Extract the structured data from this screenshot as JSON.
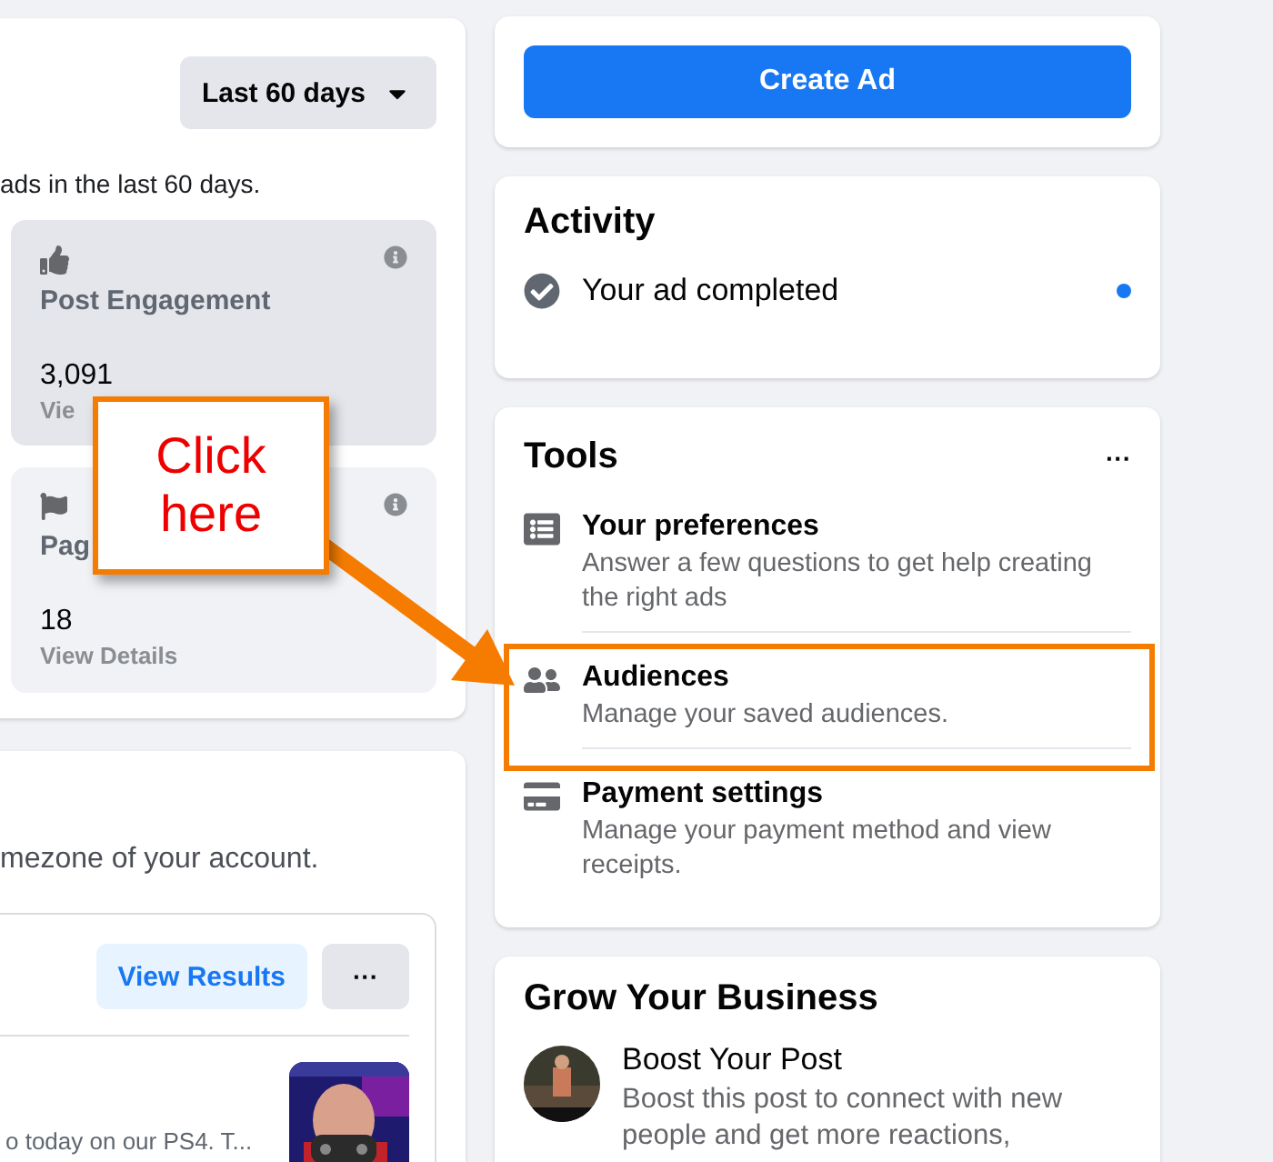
{
  "date_filter": {
    "label": "Last 60 days"
  },
  "summary": "ads in the last 60 days.",
  "stats": [
    {
      "kind": "engagement",
      "title": "Post Engagement",
      "value": "3,091",
      "link": "Vie",
      "highlighted": true
    },
    {
      "kind": "page",
      "title": "Pag",
      "value": "18",
      "link": "View Details",
      "highlighted": false
    }
  ],
  "timezone_note": "mezone of your account.",
  "ad_result": {
    "view_button": "View Results",
    "more": "···",
    "post_text": "o today on our PS4. T..."
  },
  "create_ad": "Create Ad",
  "activity": {
    "title": "Activity",
    "items": [
      {
        "text": "Your ad completed",
        "unread": true
      }
    ]
  },
  "tools": {
    "title": "Tools",
    "more": "···",
    "items": [
      {
        "kind": "preferences",
        "title": "Your preferences",
        "description": "Answer a few questions to get help creating the right ads",
        "highlighted": false
      },
      {
        "kind": "audiences",
        "title": "Audiences",
        "description": "Manage your saved audiences.",
        "highlighted": true
      },
      {
        "kind": "payment",
        "title": "Payment settings",
        "description": "Manage your payment method and view receipts.",
        "highlighted": false
      }
    ]
  },
  "grow": {
    "title": "Grow Your Business",
    "items": [
      {
        "title": "Boost Your Post",
        "description": "Boost this post to connect with new people and get more reactions,"
      }
    ]
  },
  "annotation": {
    "callout": "Click here"
  }
}
